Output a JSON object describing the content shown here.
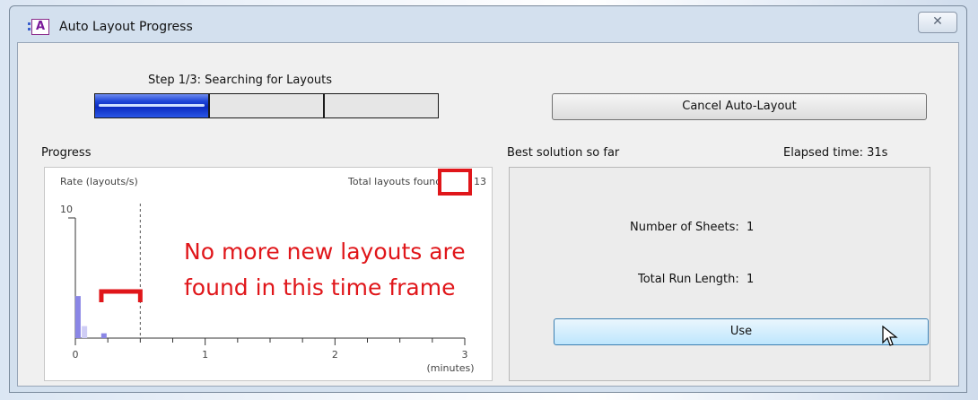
{
  "window": {
    "title": "Auto Layout Progress",
    "app_icon_text": "A",
    "close_glyph": "✕"
  },
  "step": {
    "label": "Step 1/3: Searching for Layouts",
    "current": 1,
    "total": 3
  },
  "buttons": {
    "cancel_label": "Cancel Auto-Layout",
    "use_label": "Use"
  },
  "progress": {
    "section_label": "Progress",
    "total_found_label": "Total layouts found",
    "total_found_value": "13"
  },
  "chart_data": {
    "type": "bar",
    "ylabel": "Rate (layouts/s)",
    "ylim": [
      0,
      10
    ],
    "y_ticks": [
      "10"
    ],
    "xlabel": "(minutes)",
    "x_ticks": [
      "0",
      "1",
      "2",
      "3"
    ],
    "xlim": [
      0,
      3
    ],
    "bars": [
      {
        "x": 0.02,
        "value": 3.5,
        "color": "#8a86e6"
      },
      {
        "x": 0.07,
        "value": 1.0,
        "color": "#cfcdf5"
      },
      {
        "x": 0.22,
        "value": 0.4,
        "color": "#8a86e6"
      }
    ],
    "marker_x": 0.5,
    "bracket_from": 0.2,
    "bracket_to": 0.5
  },
  "annotation": {
    "line1": "No more new layouts are",
    "line2": "found in this time frame",
    "color": "#e0161a"
  },
  "best": {
    "section_label": "Best solution so far",
    "elapsed_label": "Elapsed time: 31s",
    "sheets_label": "Number of Sheets:",
    "sheets_value": "1",
    "run_length_label": "Total Run Length:",
    "run_length_value": "1"
  }
}
